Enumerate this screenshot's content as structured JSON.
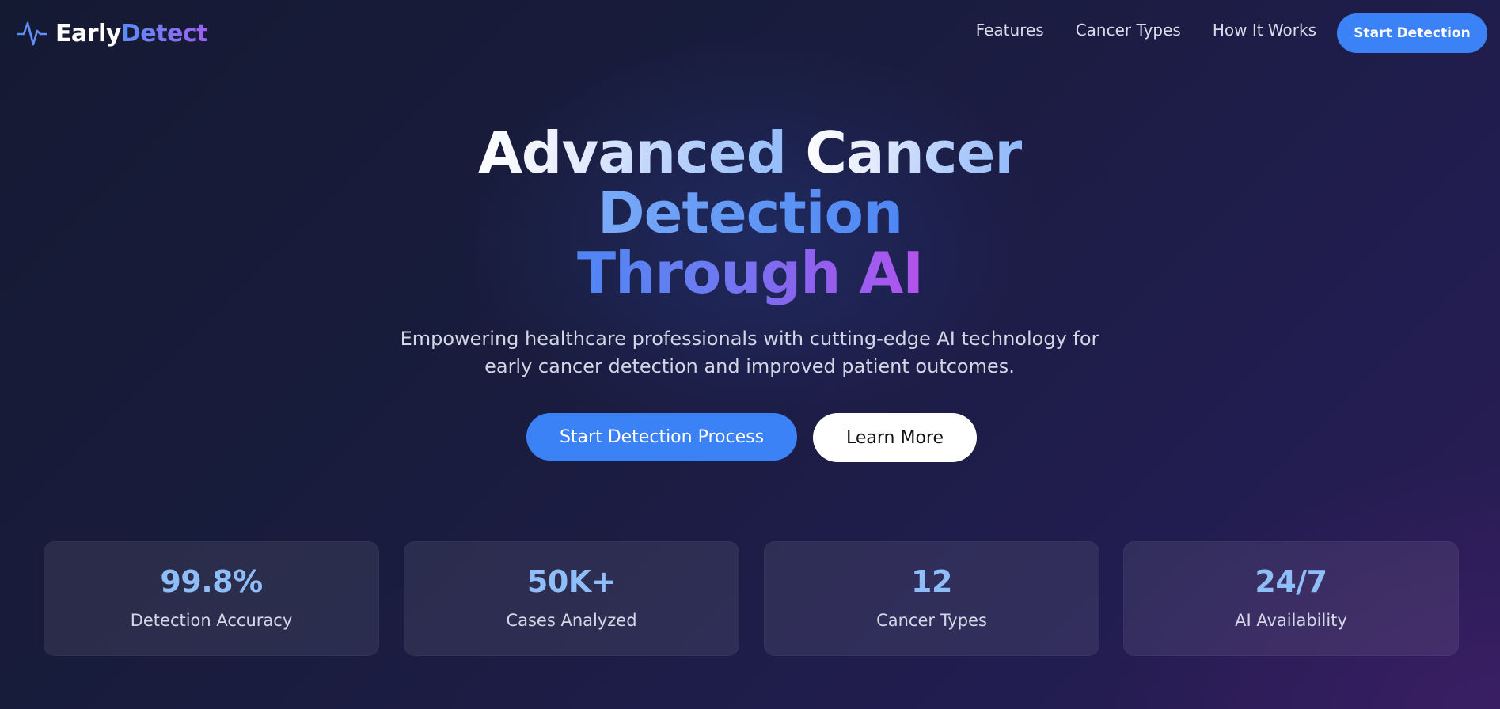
{
  "nav": {
    "logo": {
      "part1": "Early",
      "part2": "Detect",
      "icon": "pulse-icon"
    },
    "links": [
      "Features",
      "Cancer Types",
      "How It Works"
    ],
    "cta": "Start Detection"
  },
  "hero": {
    "title": {
      "line1a": "Advanced ",
      "line1b": "Cancer",
      "line2": "Detection",
      "line3a": "Through ",
      "line3b": "AI"
    },
    "subtitle_line1": "Empowering healthcare professionals with cutting-edge AI technology for",
    "subtitle_line2": "early cancer detection and improved patient outcomes.",
    "primary_button": "Start Detection Process",
    "secondary_button": "Learn More"
  },
  "stats": [
    {
      "value": "99.8%",
      "label": "Detection Accuracy"
    },
    {
      "value": "50K+",
      "label": "Cases Analyzed"
    },
    {
      "value": "12",
      "label": "Cancer Types"
    },
    {
      "value": "24/7",
      "label": "AI Availability"
    }
  ],
  "colors": {
    "accent_blue": "#3b82f6",
    "stat_value": "#8fbdf7",
    "gradient_purple": "#a457ec"
  }
}
